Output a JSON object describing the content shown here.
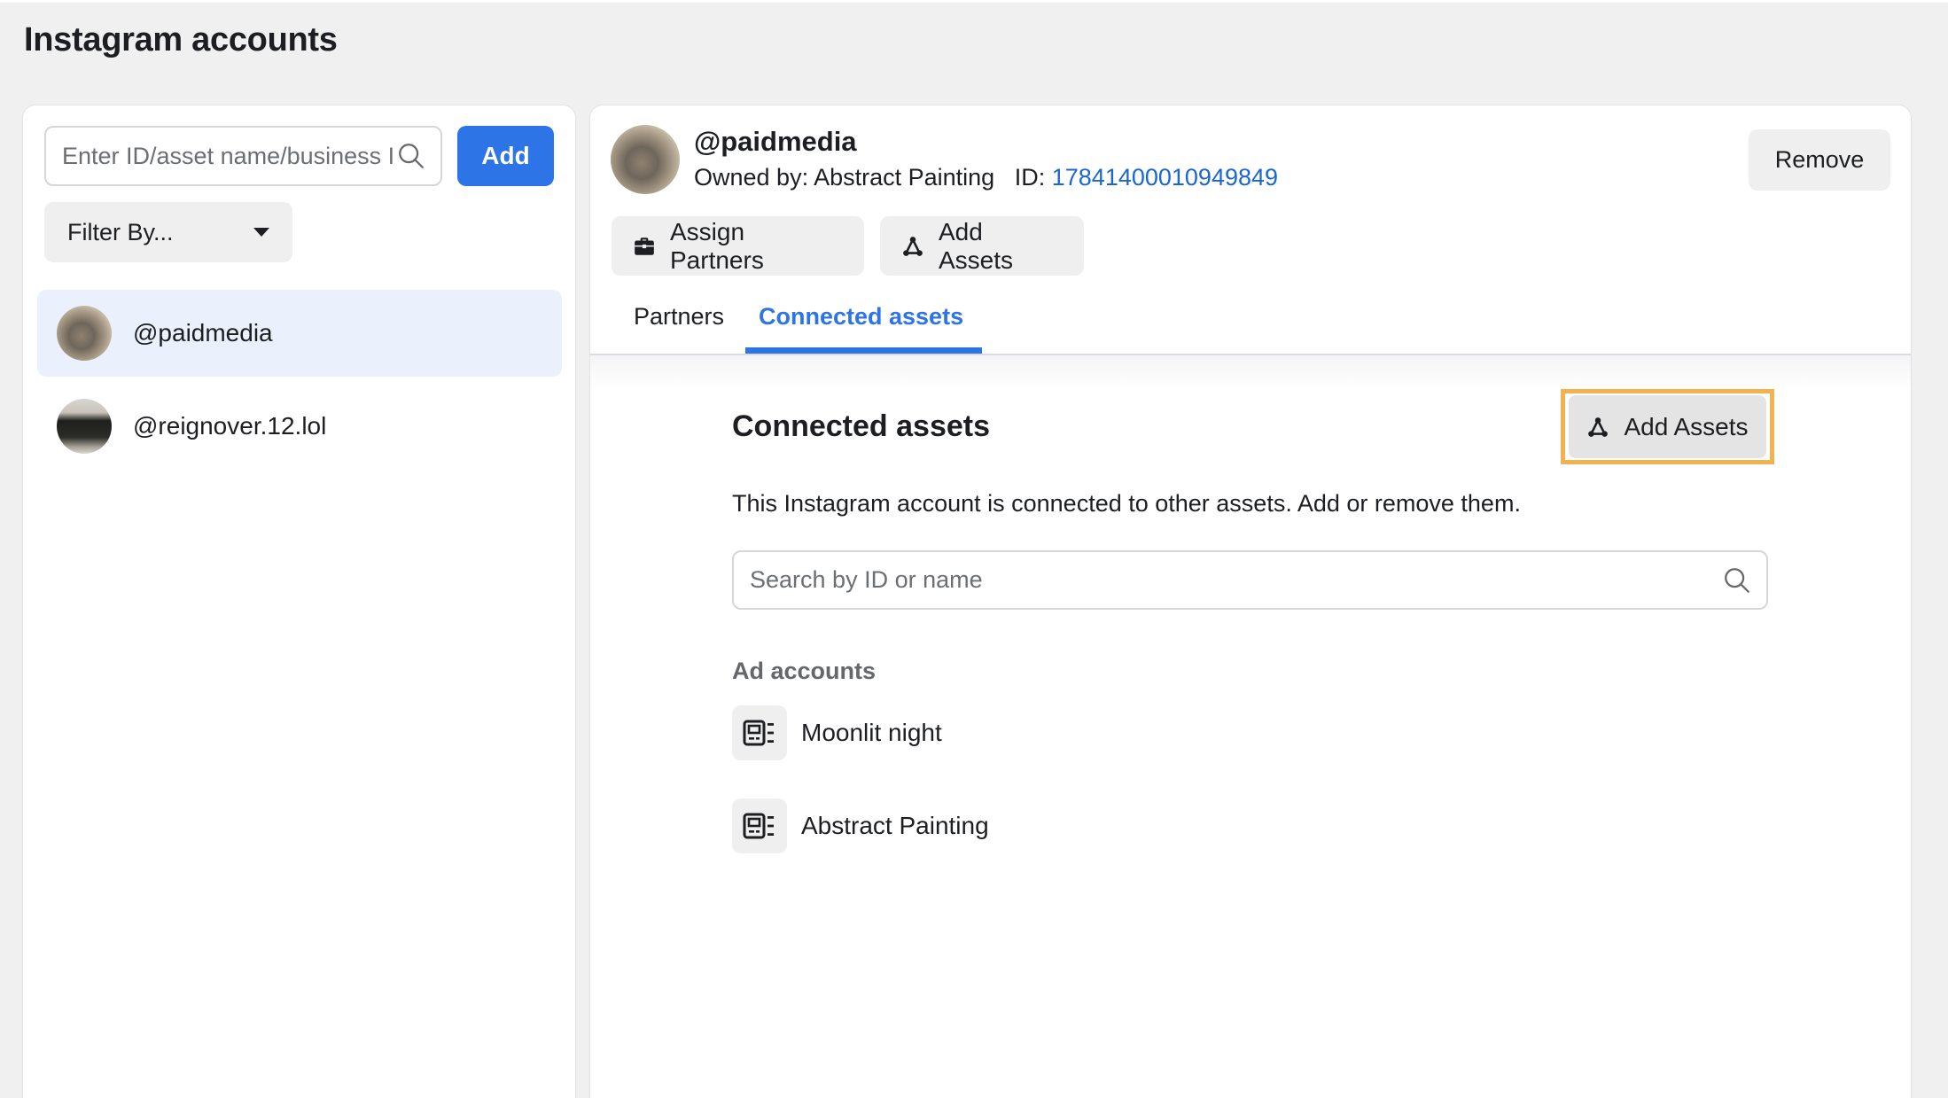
{
  "page": {
    "title": "Instagram accounts"
  },
  "sidebar": {
    "search": {
      "placeholder": "Enter ID/asset name/business ID",
      "value": ""
    },
    "add_label": "Add",
    "filter_label": "Filter By...",
    "accounts": [
      {
        "handle": "@paidmedia",
        "selected": true,
        "avatar": "kitten-photo"
      },
      {
        "handle": "@reignover.12.lol",
        "selected": false,
        "avatar": "night-landscape-photo"
      }
    ]
  },
  "detail": {
    "handle": "@paidmedia",
    "owned_by_label": "Owned by:",
    "owner": "Abstract Painting",
    "id_label": "ID:",
    "id_value": "17841400010949849",
    "remove_label": "Remove",
    "actions": [
      {
        "label": "Assign Partners",
        "icon": "briefcase-icon"
      },
      {
        "label": "Add Assets",
        "icon": "asset-network-icon"
      }
    ],
    "tabs": [
      {
        "label": "Partners",
        "active": false
      },
      {
        "label": "Connected assets",
        "active": true
      }
    ],
    "connected_assets": {
      "title": "Connected assets",
      "add_label": "Add Assets",
      "description": "This Instagram account is connected to other assets. Add or remove them.",
      "search": {
        "placeholder": "Search by ID or name",
        "value": ""
      },
      "section_title": "Ad accounts",
      "items": [
        {
          "name": "Moonlit night",
          "icon": "ad-account-icon"
        },
        {
          "name": "Abstract Painting",
          "icon": "ad-account-icon"
        }
      ]
    }
  },
  "colors": {
    "accent": "#2d74e6",
    "link": "#1a66d2",
    "highlight_outline": "#f2b24f",
    "selected_bg": "#ebf1fc",
    "page_bg": "#f0f0f0"
  }
}
